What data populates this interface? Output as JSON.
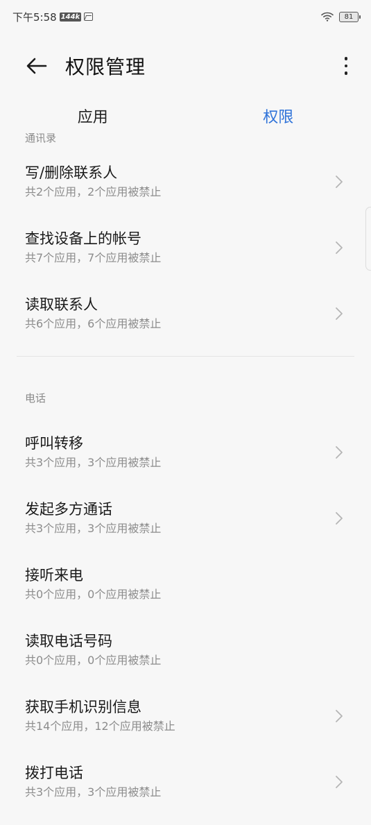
{
  "status_bar": {
    "time": "下午5:58",
    "network_speed": "144k",
    "battery": "81"
  },
  "header": {
    "title": "权限管理"
  },
  "tabs": [
    {
      "label": "应用",
      "active": false
    },
    {
      "label": "权限",
      "active": true
    }
  ],
  "sections": [
    {
      "header": "通讯录",
      "items": [
        {
          "title": "写/删除联系人",
          "subtitle": "共2个应用，2个应用被禁止",
          "chevron": true
        },
        {
          "title": "查找设备上的帐号",
          "subtitle": "共7个应用，7个应用被禁止",
          "chevron": true
        },
        {
          "title": "读取联系人",
          "subtitle": "共6个应用，6个应用被禁止",
          "chevron": true
        }
      ]
    },
    {
      "header": "电话",
      "items": [
        {
          "title": "呼叫转移",
          "subtitle": "共3个应用，3个应用被禁止",
          "chevron": true
        },
        {
          "title": "发起多方通话",
          "subtitle": "共3个应用，3个应用被禁止",
          "chevron": true
        },
        {
          "title": "接听来电",
          "subtitle": "共0个应用，0个应用被禁止",
          "chevron": false
        },
        {
          "title": "读取电话号码",
          "subtitle": "共0个应用，0个应用被禁止",
          "chevron": false
        },
        {
          "title": "获取手机识别信息",
          "subtitle": "共14个应用，12个应用被禁止",
          "chevron": true
        },
        {
          "title": "拨打电话",
          "subtitle": "共3个应用，3个应用被禁止",
          "chevron": true
        }
      ]
    }
  ],
  "colors": {
    "accent": "#2f73d9",
    "background": "#f7f7f7",
    "subtitle": "#8c8c8c"
  }
}
